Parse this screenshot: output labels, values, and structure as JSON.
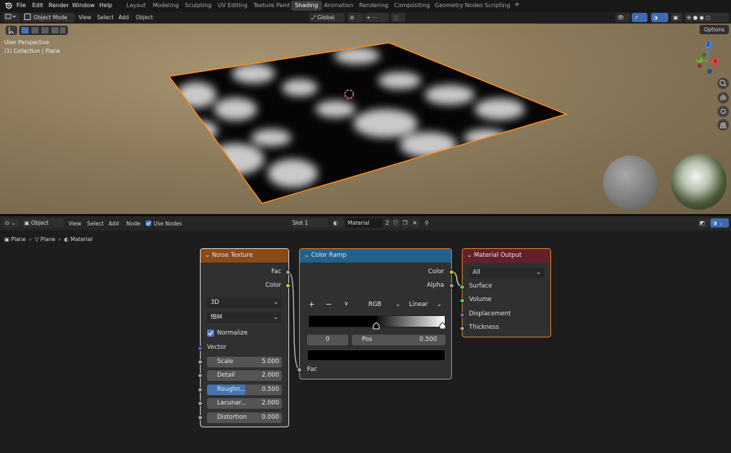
{
  "menu": {
    "items": [
      "File",
      "Edit",
      "Render",
      "Window",
      "Help"
    ],
    "workspaces": [
      "Layout",
      "Modeling",
      "Sculpting",
      "UV Editing",
      "Texture Paint",
      "Shading",
      "Animation",
      "Rendering",
      "Compositing",
      "Geometry Nodes",
      "Scripting"
    ],
    "active_workspace": "Shading",
    "add_icon": "+"
  },
  "viewport_header": {
    "mode": "Object Mode",
    "menus": [
      "View",
      "Select",
      "Add",
      "Object"
    ],
    "transform": "Global",
    "options": "Options"
  },
  "viewport": {
    "perspective": "User Perspective",
    "collection": "(1) Collection | Plane",
    "gizmo": {
      "x": "X",
      "y": "Y",
      "z": "Z"
    }
  },
  "node_header": {
    "mode": "Object",
    "menus": [
      "View",
      "Select",
      "Add",
      "Node"
    ],
    "use_nodes": "Use Nodes",
    "slot": "Slot 1",
    "material": "Material",
    "user_count": "2"
  },
  "breadcrumb": [
    "Plane",
    "Plane",
    "Material"
  ],
  "noise_texture": {
    "title": "Noise Texture",
    "out_fac": "Fac",
    "out_color": "Color",
    "dimensions": "3D",
    "type": "fBM",
    "normalize": "Normalize",
    "vector": "Vector",
    "fields": [
      {
        "label": "Scale",
        "value": "5.000"
      },
      {
        "label": "Detail",
        "value": "2.000"
      },
      {
        "label": "Roughn...",
        "value": "0.500",
        "fill": 0.5
      },
      {
        "label": "Lacunar...",
        "value": "2.000"
      },
      {
        "label": "Distortion",
        "value": "0.000"
      }
    ]
  },
  "color_ramp": {
    "title": "Color Ramp",
    "out_color": "Color",
    "out_alpha": "Alpha",
    "add": "+",
    "remove": "−",
    "more": "∨",
    "color_mode": "RGB",
    "interpolation": "Linear",
    "stop_index": "0",
    "pos_label": "Pos",
    "pos_value": "0.500",
    "in_fac": "Fac"
  },
  "material_output": {
    "title": "Material Output",
    "target": "All",
    "inputs": [
      "Surface",
      "Volume",
      "Displacement",
      "Thickness"
    ]
  },
  "colors": {
    "noise_header": "#8a4a18",
    "ramp_header": "#24608a",
    "output_header": "#64202a",
    "selection": "#ff8c1a",
    "socket_yellow": "#c7c729",
    "socket_gray": "#a1a1a1",
    "socket_green": "#63c763",
    "socket_blue": "#6363c7"
  }
}
